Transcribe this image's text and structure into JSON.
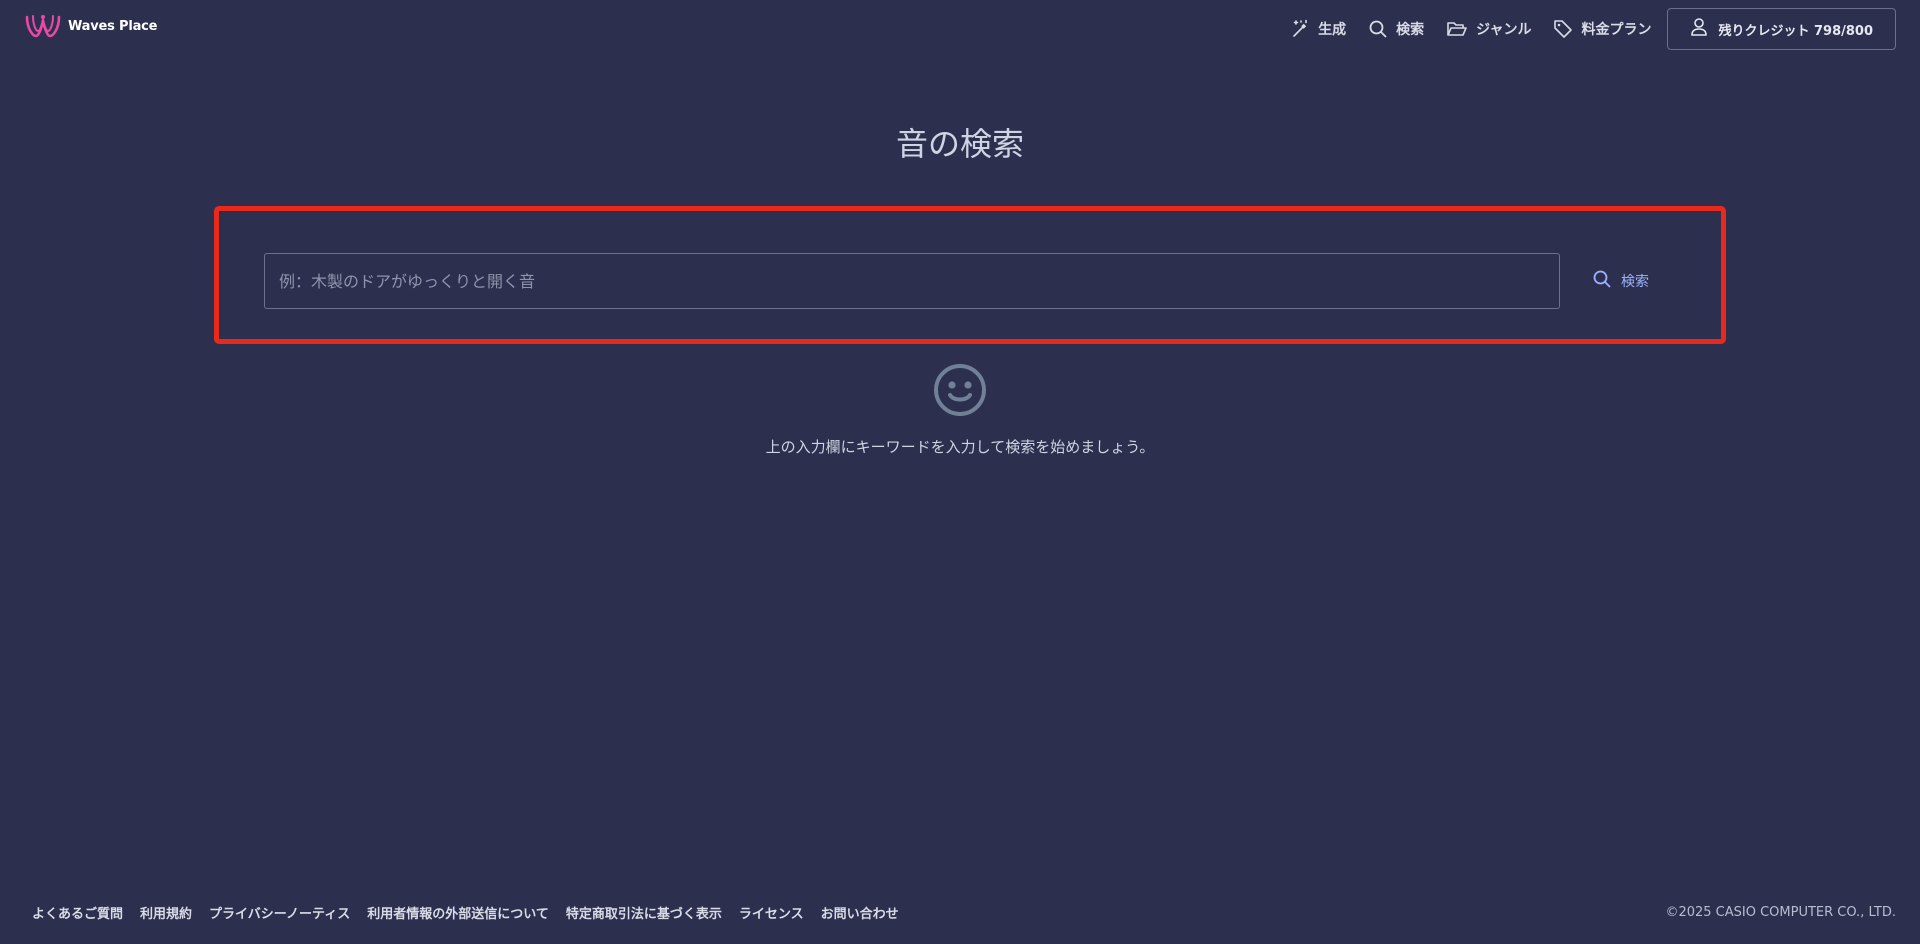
{
  "app": {
    "name": "Waves Place"
  },
  "colors": {
    "background": "#2c2f4d",
    "accent": "#9db1ff",
    "highlight_border": "#e8291c",
    "logo_pink": "#e94aa6"
  },
  "header": {
    "nav": [
      {
        "label": "生成",
        "icon": "magic-wand-icon"
      },
      {
        "label": "検索",
        "icon": "search-icon"
      },
      {
        "label": "ジャンル",
        "icon": "folder-icon"
      },
      {
        "label": "料金プラン",
        "icon": "tag-icon"
      }
    ],
    "credit_button": {
      "label": "残りクレジット 798/800",
      "icon": "user-icon"
    }
  },
  "main": {
    "title": "音の検索",
    "search": {
      "placeholder": "例：木製のドアがゆっくりと開く音",
      "value": "",
      "button_label": "検索"
    },
    "empty_state": {
      "icon": "smiley-icon",
      "message": "上の入力欄にキーワードを入力して検索を始めましょう。"
    }
  },
  "footer": {
    "links": [
      "よくあるご質問",
      "利用規約",
      "プライバシーノーティス",
      "利用者情報の外部送信について",
      "特定商取引法に基づく表示",
      "ライセンス",
      "お問い合わせ"
    ],
    "copyright": "©2025 CASIO COMPUTER CO., LTD."
  }
}
